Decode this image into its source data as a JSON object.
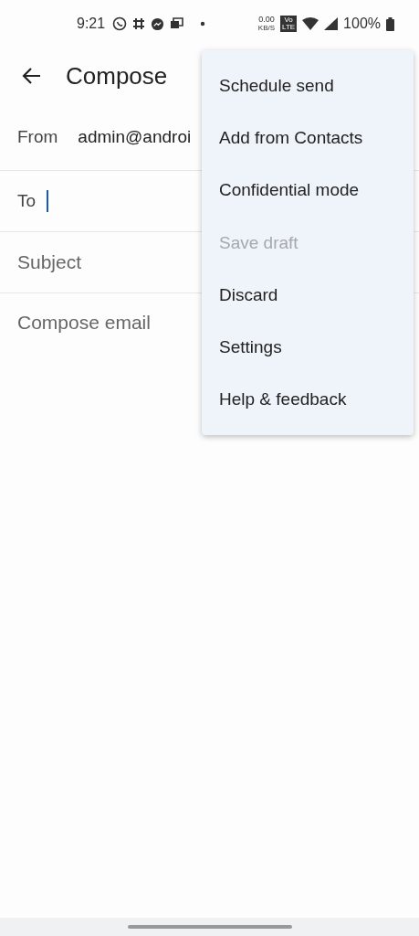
{
  "status_bar": {
    "time": "9:21",
    "net_speed": "0.00",
    "net_unit": "KB/S",
    "volte": "Vo LTE",
    "battery": "100%"
  },
  "header": {
    "title": "Compose"
  },
  "form": {
    "from_label": "From",
    "from_value": "admin@androi",
    "to_label": "To",
    "subject_placeholder": "Subject",
    "body_placeholder": "Compose email"
  },
  "menu": [
    {
      "label": "Schedule send",
      "disabled": false
    },
    {
      "label": "Add from Contacts",
      "disabled": false
    },
    {
      "label": "Confidential mode",
      "disabled": false
    },
    {
      "label": "Save draft",
      "disabled": true
    },
    {
      "label": "Discard",
      "disabled": false
    },
    {
      "label": "Settings",
      "disabled": false
    },
    {
      "label": "Help & feedback",
      "disabled": false
    }
  ]
}
